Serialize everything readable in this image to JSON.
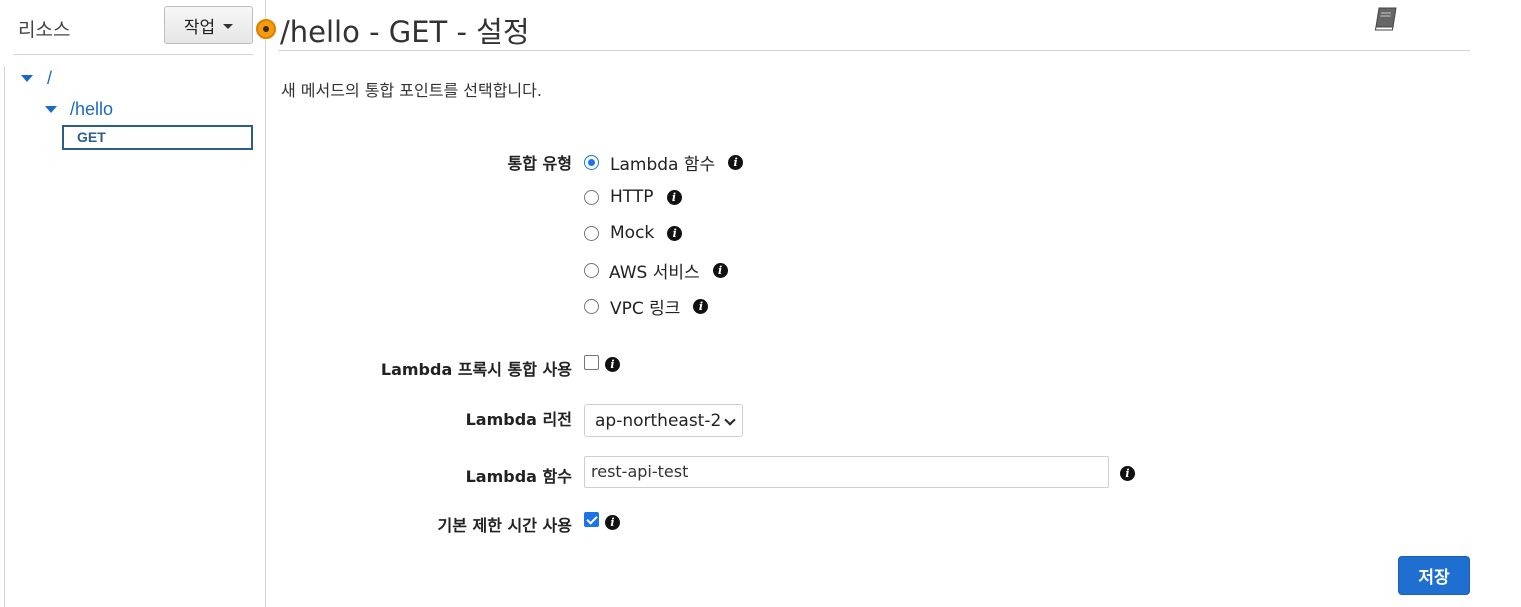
{
  "sidebar": {
    "title": "리소스",
    "actions_label": "작업",
    "tree": {
      "root": "/",
      "child": "/hello",
      "method": "GET"
    }
  },
  "main": {
    "title": "/hello - GET - 설정",
    "description": "새 메서드의 통합 포인트를 선택합니다.",
    "integration_type": {
      "label": "통합 유형",
      "options": [
        "Lambda 함수",
        "HTTP",
        "Mock",
        "AWS 서비스",
        "VPC 링크"
      ],
      "selected": "Lambda 함수"
    },
    "proxy": {
      "label": "Lambda 프록시 통합 사용",
      "checked": false
    },
    "region": {
      "label": "Lambda 리전",
      "value": "ap-northeast-2"
    },
    "function": {
      "label": "Lambda 함수",
      "value": "rest-api-test"
    },
    "timeout": {
      "label": "기본 제한 시간 사용",
      "checked": true
    },
    "save_label": "저장"
  },
  "colors": {
    "accent": "#1f6fd0",
    "link": "#1a6bbf",
    "indicator": "#f39c12"
  },
  "icons": [
    "caret-down-icon",
    "book-icon",
    "info-icon",
    "status-indicator-icon"
  ]
}
